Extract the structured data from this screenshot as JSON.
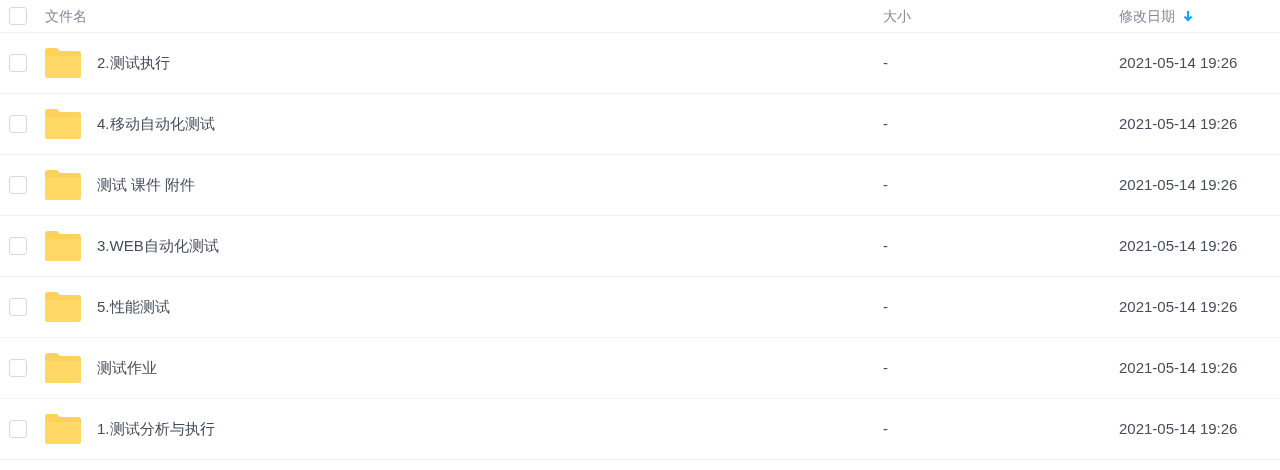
{
  "header": {
    "checked": false,
    "columns": [
      {
        "label": "文件名",
        "sorted": false
      },
      {
        "label": "大小",
        "sorted": false
      },
      {
        "label": "修改日期",
        "sorted": true
      }
    ]
  },
  "rows": [
    {
      "name": "2.测试执行",
      "size": "-",
      "modified": "2021-05-14 19:26",
      "checked": false
    },
    {
      "name": "4.移动自动化测试",
      "size": "-",
      "modified": "2021-05-14 19:26",
      "checked": false
    },
    {
      "name": "测试 课件 附件",
      "size": "-",
      "modified": "2021-05-14 19:26",
      "checked": false
    },
    {
      "name": "3.WEB自动化测试",
      "size": "-",
      "modified": "2021-05-14 19:26",
      "checked": false
    },
    {
      "name": "5.性能测试",
      "size": "-",
      "modified": "2021-05-14 19:26",
      "checked": false
    },
    {
      "name": "测试作业",
      "size": "-",
      "modified": "2021-05-14 19:26",
      "checked": false
    },
    {
      "name": "1.测试分析与执行",
      "size": "-",
      "modified": "2021-05-14 19:26",
      "checked": false
    }
  ]
}
